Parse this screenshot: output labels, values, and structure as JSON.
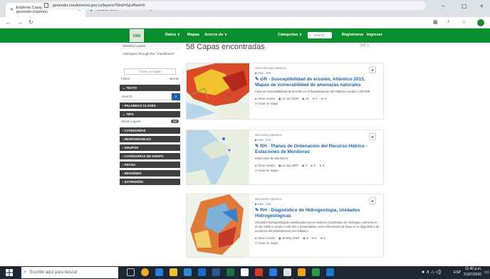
{
  "browser": {
    "tabs": [
      {
        "title": "Explorar Capas - geonodo.crautono",
        "active": true
      },
      {
        "title": "Intranet CRA",
        "active": false
      }
    ],
    "new_tab": "+",
    "url": "geonodo.crautonoma.gov.co/layers/?limit=5&offset=0"
  },
  "header": {
    "logo_text": "CRA",
    "nav": [
      "Datos ∨",
      "Mapas",
      "Acerca de ∨"
    ],
    "categorias": "Categorías ∨",
    "search_placeholder": "Search",
    "register": "Registrarse",
    "login": "Ingresar",
    "bg_color": "#0b8f2e"
  },
  "sidebar": {
    "selected_layers": "Selected Layers",
    "add_layers_hint": "Add layers through the \"checkboxes\".",
    "create_map_btn": "Crear un mapa",
    "filtros": "Filtros",
    "borrar": "Borrar",
    "texto": "TEXTO",
    "search_placeholder": "Search",
    "sections": [
      "PALABRAS CLAVES",
      "TIPO"
    ],
    "vector_layers": "Vector Layers",
    "vector_count": "58",
    "sections2": [
      "CATEGORÍAS",
      "RESPONSABLES",
      "GRUPOS",
      "CATEGORÍAS DE GRUPO",
      "FECHA",
      "REGIONES",
      "EXTENSIÓN"
    ]
  },
  "main": {
    "title": "58 Capas encontradas",
    "sort": "Ord ∨",
    "cards": [
      {
        "category": "GESTIÓN DEL RIESGO",
        "tag": "CRA - GIS",
        "title": "GR - Susceptibilidad de erosión, Atlántico 2015, Mapas de vulnerabilidad de amenazas naturales",
        "desc": "Capa de Susceptibilidad de Erosión en el Departamento del Atlántico escala 1:100.000",
        "author": "Omar Acosta",
        "date": "12 Jun 2020",
        "views": "12",
        "shares": "0",
        "rating": "0",
        "map_link": "Crear un mapa"
      },
      {
        "category": "RECURSO HÍDRICO",
        "tag": "CRA - GIS",
        "title": "RH - Planes de Ordenación del Recurso Hídrico - Estaciones de Monitoreo",
        "desc": "Estaciones de Monitoreo",
        "author": "Omar Acosta",
        "date": "11 Jun 2020",
        "views": "0",
        "shares": "0",
        "rating": "0",
        "map_link": "Crear un mapa"
      },
      {
        "category": "RECURSO HÍDRICO",
        "tag": "CRA - GIS",
        "title": "RH - Diagnóstico de Hidrogeología, Unidades Hidrogeológicas",
        "desc": "Unidades hidrogeológicas identificadas por el Instituto Colombiano de Geología y Minería en el año 1995 a escala 1:100.000 y presentadas como información de base en el diagnóstico de acuíferos del departamento del Atlántico.",
        "author": "Omar Acosta",
        "date": "18 May 2020",
        "views": "0",
        "shares": "0",
        "rating": "0",
        "map_link": "Crear un mapa"
      }
    ]
  },
  "taskbar": {
    "search_placeholder": "Escribe aquí para buscar",
    "lang": "ESP",
    "time": "11:40 p.m.",
    "date": "21/07/2020"
  }
}
